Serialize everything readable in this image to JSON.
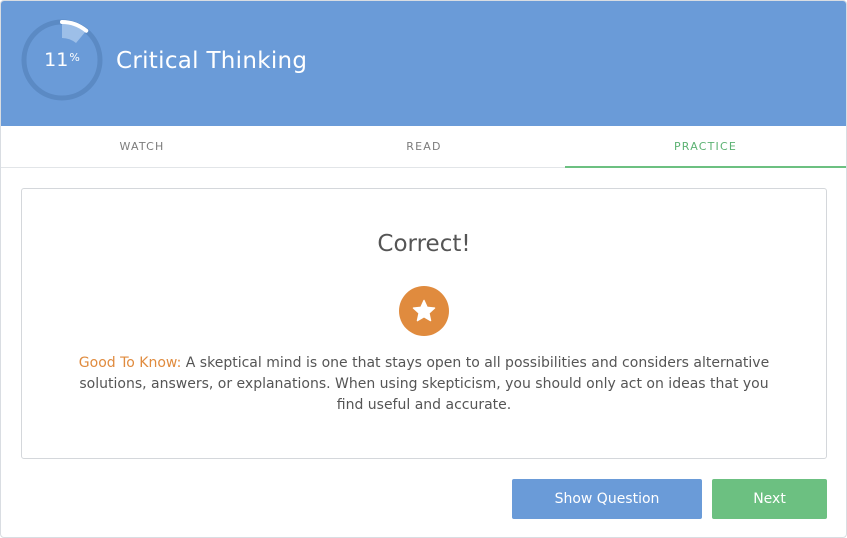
{
  "header": {
    "title": "Critical Thinking",
    "progress": {
      "value": "11",
      "unit": "%",
      "fraction": 0.11
    },
    "colors": {
      "background": "#6a9bd8"
    }
  },
  "tabs": [
    {
      "label": "WATCH",
      "active": false
    },
    {
      "label": "READ",
      "active": false
    },
    {
      "label": "PRACTICE",
      "active": true
    }
  ],
  "result": {
    "title": "Correct!",
    "badge_icon": "star-icon",
    "tip_label": "Good To Know:",
    "tip_text": " A skeptical mind is one that stays open to all possibilities and considers alternative solutions, answers, or explanations. When using skepticism, you should only act on ideas that you find useful and accurate."
  },
  "buttons": {
    "show_question": "Show Question",
    "next": "Next"
  },
  "colors": {
    "accent_green": "#6cc081",
    "accent_orange": "#e08b3e",
    "accent_blue": "#6a9bd8"
  }
}
